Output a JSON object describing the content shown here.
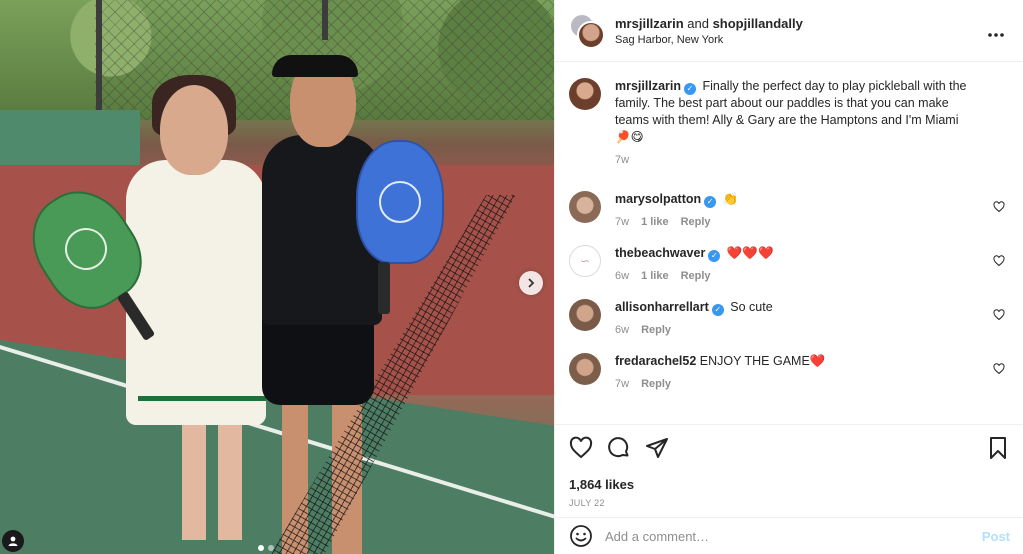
{
  "post": {
    "header": {
      "user1": "mrsjillzarin",
      "and_text": " and ",
      "user2": "shopjillandally",
      "location": "Sag Harbor, New York",
      "more_icon": "more-horizontal-icon"
    },
    "caption": {
      "username": "mrsjillzarin",
      "text": "Finally the perfect day to play pickleball with the family. The best part about our paddles is that you can make teams with them! Ally & Gary are the Hamptons and I'm Miami",
      "emoji": "🏓😋",
      "time": "7w"
    },
    "comments": [
      {
        "username": "marysolpatton",
        "verified": true,
        "text": "👏",
        "time": "7w",
        "likes": "1 like",
        "reply": "Reply"
      },
      {
        "username": "thebeachwaver",
        "verified": true,
        "text": "❤️❤️❤️",
        "time": "6w",
        "likes": "1 like",
        "reply": "Reply"
      },
      {
        "username": "allisonharrellart",
        "verified": true,
        "text": "So cute",
        "time": "6w",
        "likes": "",
        "reply": "Reply"
      },
      {
        "username": "fredarachel52",
        "verified": false,
        "text": "ENJOY THE GAME❤️",
        "time": "7w",
        "likes": "",
        "reply": "Reply"
      }
    ],
    "likes": "1,864 likes",
    "date": "JULY 22",
    "add_comment_placeholder": "Add a comment…",
    "post_label": "Post"
  },
  "colors": {
    "link_blue": "#3897f0",
    "post_disabled": "#b2dffc",
    "muted": "#8e8e8e"
  },
  "icons": [
    "heart-icon",
    "comment-icon",
    "share-icon",
    "bookmark-icon",
    "emoji-icon",
    "chevron-right-icon",
    "user-tag-icon"
  ]
}
